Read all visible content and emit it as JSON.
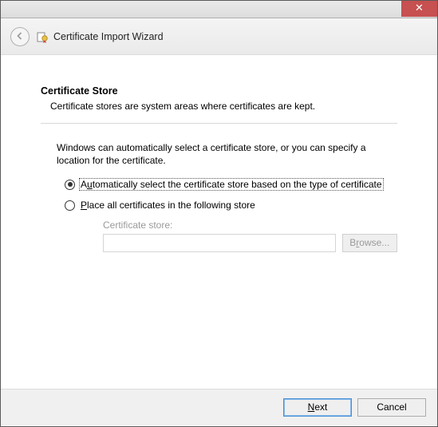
{
  "titlebar": {
    "close_glyph": "✕"
  },
  "header": {
    "title": "Certificate Import Wizard"
  },
  "section": {
    "title": "Certificate Store",
    "desc": "Certificate stores are system areas where certificates are kept."
  },
  "instruction": "Windows can automatically select a certificate store, or you can specify a location for the certificate.",
  "radios": {
    "auto_pre": "A",
    "auto_u": "u",
    "auto_post": "tomatically select the certificate store based on the type of certificate",
    "place_pre": "",
    "place_u": "P",
    "place_post": "lace all certificates in the following store"
  },
  "store": {
    "label": "Certificate store:",
    "value": "",
    "browse_pre": "B",
    "browse_u": "r",
    "browse_post": "owse..."
  },
  "footer": {
    "next_pre": "",
    "next_u": "N",
    "next_post": "ext",
    "cancel": "Cancel"
  }
}
